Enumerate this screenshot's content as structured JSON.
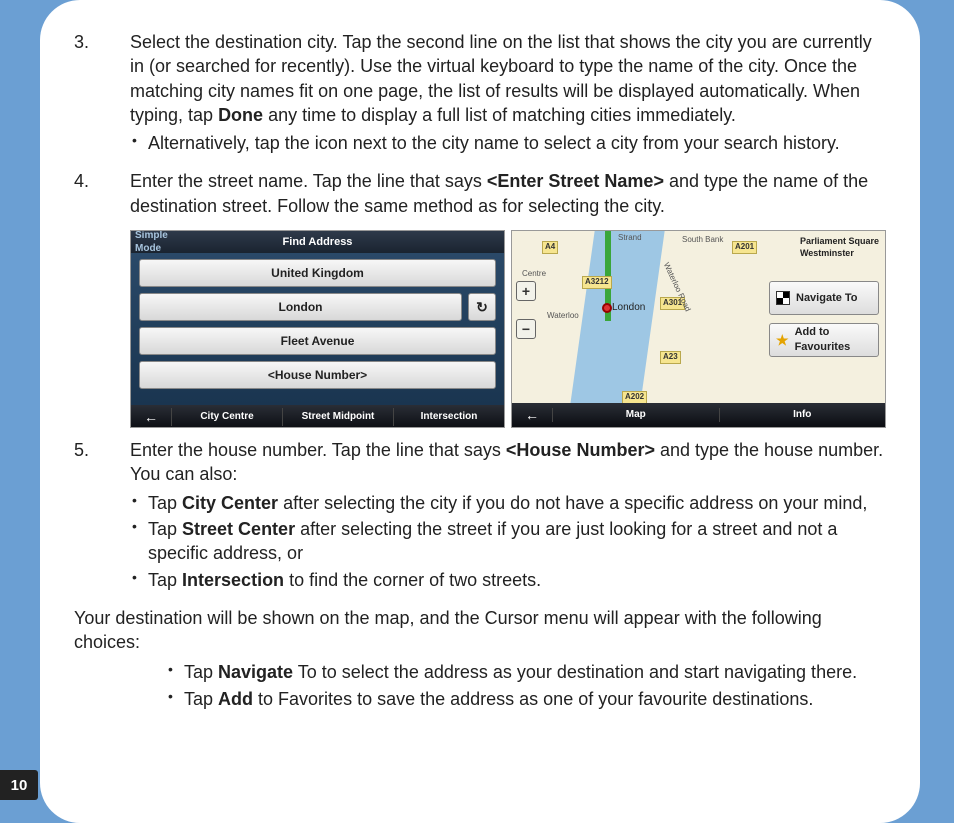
{
  "pageNumber": "10",
  "list": {
    "item3": {
      "num": "3.",
      "text_a": "Select the destination city. Tap the second line on the list that shows the city you are currently in (or searched for recently). Use the virtual keyboard to type the name of the city. Once the matching city names fit on one page, the list of results will be displayed automatically. When typing, tap ",
      "bold1": "Done",
      "text_b": " any time to display a full list of matching cities immediately.",
      "sub1": "Alternatively, tap the icon next to the city name to select a city from your search history."
    },
    "item4": {
      "num": "4.",
      "text_a": "Enter the street name. Tap the line that says ",
      "bold1": "<Enter Street Name>",
      "text_b": " and type the name of the destination street. Follow the same method as for selecting the city."
    },
    "item5": {
      "num": "5.",
      "text_a": "Enter the house number. Tap the line that says ",
      "bold1": "<House Number>",
      "text_b": " and type the house number. You can also:",
      "sub1_a": "Tap ",
      "sub1_bold": "City Center",
      "sub1_b": " after selecting the city if you do not have a specific address on your mind,",
      "sub2_a": "Tap ",
      "sub2_bold": "Street Center",
      "sub2_b": " after selecting the street if you are just looking for a street and not a specific address, or",
      "sub3_a": "Tap ",
      "sub3_bold": "Intersection",
      "sub3_b": " to find the corner of two streets."
    }
  },
  "afterPara": "Your destination will be shown on the map, and the Cursor menu will appear with the following choices:",
  "afterBullets": {
    "b1_a": "Tap ",
    "b1_bold": "Navigate",
    "b1_b": " To to select the address as your destination and start navigating there.",
    "b2_a": "Tap ",
    "b2_bold": "Add",
    "b2_b": " to Favorites to save the address as one of your favourite destinations."
  },
  "shotLeft": {
    "simpleMode": "Simple Mode",
    "title": "Find Address",
    "field1": "United Kingdom",
    "field2": "London",
    "field3": "Fleet Avenue",
    "field4": "<House Number>",
    "refresh": "↻",
    "backArrow": "←",
    "footer1": "City Centre",
    "footer2": "Street Midpoint",
    "footer3": "Intersection"
  },
  "shotRight": {
    "backArrow": "←",
    "mapLabel": "Map",
    "infoLabel": "Info",
    "calloutLine1": "Parliament Square",
    "calloutLine2": "Westminster",
    "pinLabel": "London",
    "navigateTo": "Navigate To",
    "addFav": "Add to Favourites",
    "road_a4": "A4",
    "road_a3212": "A3212",
    "road_a301": "A301",
    "road_a23": "A23",
    "road_a201": "A201",
    "road_a202": "A202",
    "road_strand": "Strand",
    "road_centre": "Centre",
    "road_waterloo": "Waterloo",
    "road_southbank": "South Bank",
    "road_waterrd": "Waterloo Road",
    "zoomIn": "+",
    "zoomOut": "−"
  }
}
